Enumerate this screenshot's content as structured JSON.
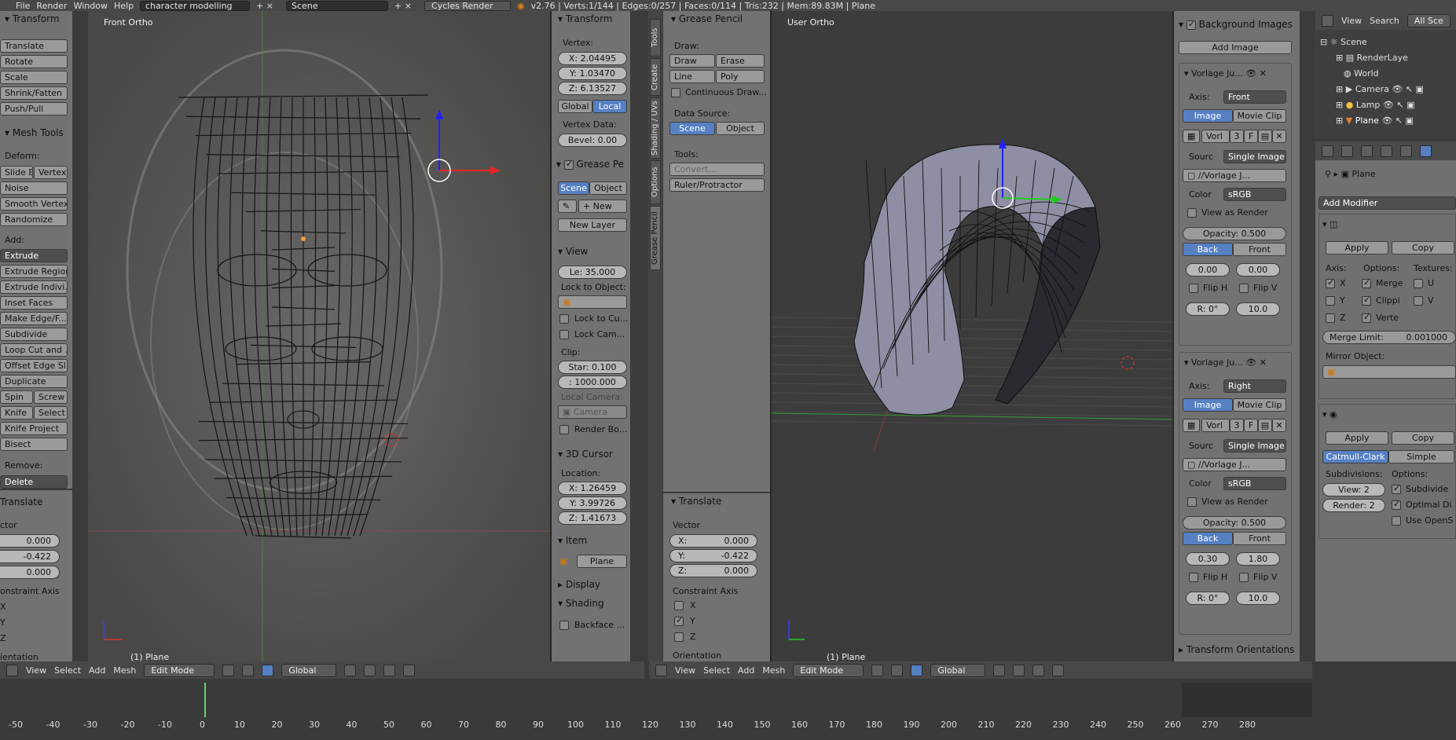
{
  "topbar": {
    "file": "File",
    "render": "Render",
    "window": "Window",
    "help": "Help",
    "screen_layout": "character modelling",
    "scene": "Scene",
    "engine": "Cycles Render",
    "stats": "v2.76 | Verts:1/144 | Edges:0/257 | Faces:0/114 | Tris:232 | Mem:89.83M | Plane"
  },
  "tools": {
    "transform_header": "Transform",
    "translate": "Translate",
    "rotate": "Rotate",
    "scale": "Scale",
    "shrink": "Shrink/Fatten",
    "push": "Push/Pull",
    "mesh_header": "Mesh Tools",
    "deform": "Deform:",
    "slide": "Slide E",
    "vertex": "Vertex",
    "noise": "Noise",
    "smooth": "Smooth Vertex",
    "randomize": "Randomize",
    "add": "Add:",
    "extrude": "Extrude",
    "extrude_region": "Extrude Region",
    "extrude_indiv": "Extrude Indivi...",
    "inset": "Inset Faces",
    "make_edge": "Make Edge/F...",
    "subdivide": "Subdivide",
    "loopcut": "Loop Cut and ...",
    "offset": "Offset Edge Sl...",
    "duplicate": "Duplicate",
    "spin": "Spin",
    "screw": "Screw",
    "knife": "Knife",
    "select": "Select",
    "knife_project": "Knife Project",
    "bisect": "Bisect",
    "remove": "Remove:",
    "delete": "Delete"
  },
  "op_left": {
    "header": "Translate",
    "vector": "ctor",
    "x": "0.000",
    "y": "-0.422",
    "z": "0.000",
    "constraint": "onstraint Axis",
    "ax": "X",
    "ay": "Y",
    "az": "Z",
    "orient": "ientation"
  },
  "viewport_left": {
    "label": "Front Ortho",
    "object": "(1) Plane",
    "menus": [
      "View",
      "Select",
      "Add",
      "Mesh"
    ],
    "mode": "Edit Mode",
    "orient": "Global"
  },
  "props_n": {
    "transform": "Transform",
    "vertex": "Vertex:",
    "vx": "X: 2.04495",
    "vy": "Y: 1.03470",
    "vz": "Z: 6.13527",
    "global": "Global",
    "local": "Local",
    "vdata": "Vertex Data:",
    "bevel": "Bevel: 0.00",
    "gp": "Grease Pe",
    "scene": "Scene",
    "object": "Object",
    "new": "New",
    "newlayer": "New Layer",
    "view": "View",
    "lens": "Le: 35.000",
    "lockobj": "Lock to Object:",
    "lockcu": "Lock to Cu...",
    "lockcam": "Lock Cam...",
    "clip": "Clip:",
    "start": "Star: 0.100",
    "end": ": 1000.000",
    "localcam": "Local Camera:",
    "camera": "Camera",
    "renderbo": "Render Bo...",
    "cursor": "3D Cursor",
    "location": "Location:",
    "cx": "X: 1.26459",
    "cy": "Y: 3.99726",
    "cz": "Z: 1.41673",
    "item": "Item",
    "plane": "Plane",
    "display": "Display",
    "shading": "Shading",
    "backface": "Backface ..."
  },
  "tabs": [
    "Tools",
    "Create",
    "Shading / UVs",
    "Options",
    "Grease Pencil"
  ],
  "gp_panel": {
    "header": "Grease Pencil",
    "draw": "Draw:",
    "draw_btn": "Draw",
    "erase": "Erase",
    "line": "Line",
    "poly": "Poly",
    "continuous": "Continuous Draw...",
    "datasrc": "Data Source:",
    "scene": "Scene",
    "object": "Object",
    "tools": "Tools:",
    "convert": "Convert...",
    "ruler": "Ruler/Protractor"
  },
  "op_mid": {
    "header": "Translate",
    "vector": "Vector",
    "x": "0.000",
    "y": "-0.422",
    "z": "0.000",
    "constraint": "Constraint Axis",
    "ax": "X",
    "ay": "Y",
    "az": "Z",
    "orient": "Orientation"
  },
  "viewport_right": {
    "label": "User Ortho",
    "object": "(1) Plane",
    "menus": [
      "View",
      "Select",
      "Add",
      "Mesh"
    ],
    "mode": "Edit Mode",
    "orient": "Global"
  },
  "bg_images": {
    "header": "Background Images",
    "add": "Add Image",
    "img1": {
      "name": "Vorlage Ju...",
      "axis_label": "Axis:",
      "axis": "Front",
      "image": "Image",
      "movie": "Movie Clip",
      "vorl": "Vorl",
      "n3": "3",
      "f": "F",
      "source_label": "Sourc",
      "source": "Single Image",
      "path": "//Vorlage J...",
      "color_label": "Color",
      "color": "sRGB",
      "view_render": "View as Render",
      "opacity": "Opacity:",
      "opacity_val": "0.500",
      "back": "Back",
      "front": "Front",
      "ox": "0.00",
      "oy": "0.00",
      "fliph": "Flip H",
      "flipv": "Flip V",
      "rot": "R: 0°",
      "size": "10.0"
    },
    "img2": {
      "name": "Vorlage Ju...",
      "axis_label": "Axis:",
      "axis": "Right",
      "image": "Image",
      "movie": "Movie Clip",
      "vorl": "Vorl",
      "n3": "3",
      "f": "F",
      "source_label": "Sourc",
      "source": "Single Image",
      "path": "//Vorlage J...",
      "color_label": "Color",
      "color": "sRGB",
      "view_render": "View as Render",
      "opacity": "Opacity:",
      "opacity_val": "0.500",
      "back": "Back",
      "front": "Front",
      "ox": "0.30",
      "oy": "1.80",
      "fliph": "Flip H",
      "flipv": "Flip V",
      "rot": "R: 0°",
      "size": "10.0"
    },
    "transform_orient": "Transform Orientations"
  },
  "outliner": {
    "view": "View",
    "search": "Search",
    "all": "All Sce",
    "items": [
      "Scene",
      "RenderLaye",
      "World",
      "Camera",
      "Lamp",
      "Plane"
    ]
  },
  "properties": {
    "object": "Plane",
    "add_modifier": "Add Modifier",
    "apply": "Apply",
    "copy": "Copy",
    "axis": "Axis:",
    "options": "Options:",
    "textures": "Textures:",
    "x": "X",
    "y": "Y",
    "z": "Z",
    "merge": "Merge",
    "clipping": "Clippi",
    "vertex": "Verte",
    "u": "U",
    "v": "V",
    "merge_limit": "Merge Limit:",
    "merge_val": "0.001000",
    "mirror_obj": "Mirror Object:",
    "apply2": "Apply",
    "copy2": "Copy",
    "catmull": "Catmull-Clark",
    "simple": "Simple",
    "subdivisions": "Subdivisions:",
    "options2": "Options:",
    "view_lvl": "View:",
    "view_val": "2",
    "render_lvl": "Render:",
    "render_val": "2",
    "subdiv_uv": "Subdivide",
    "optimal": "Optimal Di",
    "opensubdiv": "Use OpenS"
  },
  "timeline": {
    "ticks": [
      "-50",
      "-40",
      "-30",
      "-20",
      "-10",
      "0",
      "10",
      "20",
      "30",
      "40",
      "50",
      "60",
      "70",
      "80",
      "90",
      "100",
      "110",
      "120",
      "130",
      "140",
      "150",
      "160",
      "170",
      "180",
      "190",
      "200",
      "210",
      "220",
      "230",
      "240",
      "250",
      "260",
      "270",
      "280"
    ]
  }
}
